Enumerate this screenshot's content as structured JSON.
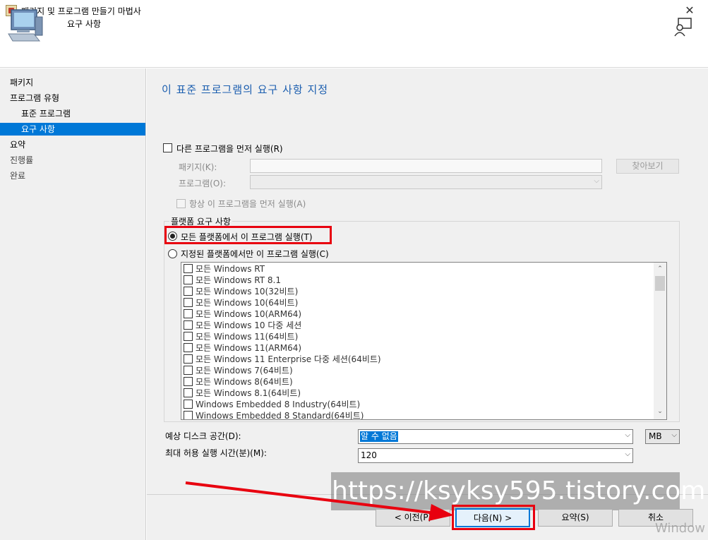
{
  "window": {
    "title": "패키지 및 프로그램 만들기 마법사"
  },
  "header": {
    "title": "요구 사항"
  },
  "sidebar": {
    "items": [
      {
        "label": "패키지"
      },
      {
        "label": "프로그램 유형"
      },
      {
        "label": "표준 프로그램"
      },
      {
        "label": "요구 사항"
      },
      {
        "label": "요약"
      },
      {
        "label": "진행률"
      },
      {
        "label": "완료"
      }
    ]
  },
  "main": {
    "title": "이 표준 프로그램의 요구 사항 지정",
    "run_other_first": {
      "label": "다른 프로그램을 먼저 실행(R)",
      "checked": false
    },
    "package_label": "패키지(K):",
    "package_value": "",
    "browse_label": "찾아보기",
    "program_label": "프로그램(O):",
    "program_value": "",
    "always_run_first": {
      "label": "항상 이 프로그램을 먼저 실행(A)",
      "checked": false
    },
    "platform_group_label": "플랫폼 요구 사항",
    "radio_all": {
      "label": "모든 플랫폼에서 이 프로그램 실행(T)",
      "selected": true
    },
    "radio_specific": {
      "label": "지정된 플랫폼에서만 이 프로그램 실행(C)",
      "selected": false
    },
    "platforms": [
      "모든 Windows RT",
      "모든 Windows RT 8.1",
      "모든 Windows 10(32비트)",
      "모든 Windows 10(64비트)",
      "모든 Windows 10(ARM64)",
      "모든 Windows 10 다중 세션",
      "모든 Windows 11(64비트)",
      "모든 Windows 11(ARM64)",
      "모든 Windows 11 Enterprise 다중 세션(64비트)",
      "모든 Windows 7(64비트)",
      "모든 Windows 8(64비트)",
      "모든 Windows 8.1(64비트)",
      "Windows Embedded 8 Industry(64비트)",
      "Windows Embedded 8 Standard(64비트)"
    ],
    "disk_space_label": "예상 디스크 공간(D):",
    "disk_space_value": "알 수 없음",
    "disk_unit": "MB",
    "max_runtime_label": "최대 허용 실행 시간(분)(M):",
    "max_runtime_value": "120"
  },
  "buttons": {
    "prev": "< 이전(P)",
    "next": "다음(N) >",
    "summary": "요약(S)",
    "cancel": "취소"
  },
  "overlay": {
    "watermark": "https://ksyksy595.tistory.com",
    "windows_watermark": "Window",
    "highlight_color": "#e8000f"
  },
  "colors": {
    "accent": "#0078d7",
    "title_blue": "#1b5eaf"
  }
}
